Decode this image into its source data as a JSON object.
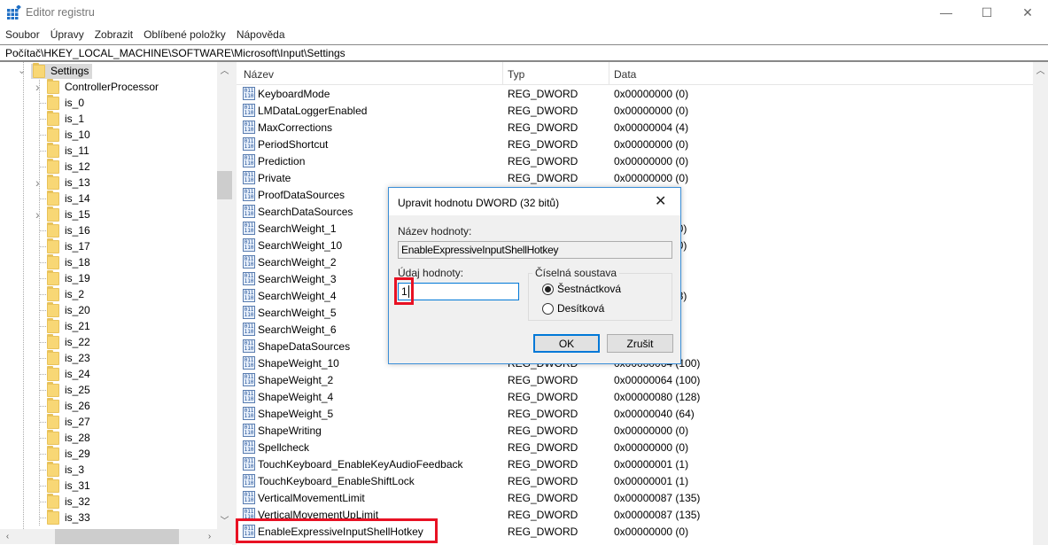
{
  "window": {
    "title": "Editor registru",
    "minimize": "—",
    "maximize": "☐",
    "close": "✕"
  },
  "menu": [
    "Soubor",
    "Úpravy",
    "Zobrazit",
    "Oblíbené položky",
    "Nápověda"
  ],
  "address": "Počítač\\HKEY_LOCAL_MACHINE\\SOFTWARE\\Microsoft\\Input\\Settings",
  "tree": {
    "selected": "Settings",
    "children": [
      {
        "label": "ControllerProcessor",
        "expandable": true
      },
      {
        "label": "is_0"
      },
      {
        "label": "is_1"
      },
      {
        "label": "is_10"
      },
      {
        "label": "is_11"
      },
      {
        "label": "is_12"
      },
      {
        "label": "is_13",
        "expandable": true
      },
      {
        "label": "is_14"
      },
      {
        "label": "is_15",
        "expandable": true
      },
      {
        "label": "is_16"
      },
      {
        "label": "is_17"
      },
      {
        "label": "is_18"
      },
      {
        "label": "is_19"
      },
      {
        "label": "is_2"
      },
      {
        "label": "is_20"
      },
      {
        "label": "is_21"
      },
      {
        "label": "is_22"
      },
      {
        "label": "is_23"
      },
      {
        "label": "is_24"
      },
      {
        "label": "is_25"
      },
      {
        "label": "is_26"
      },
      {
        "label": "is_27"
      },
      {
        "label": "is_28"
      },
      {
        "label": "is_29"
      },
      {
        "label": "is_3"
      },
      {
        "label": "is_31"
      },
      {
        "label": "is_32"
      },
      {
        "label": "is_33"
      }
    ]
  },
  "list": {
    "columns": [
      "Název",
      "Typ",
      "Data"
    ],
    "rows": [
      {
        "name": "KeyboardMode",
        "type": "REG_DWORD",
        "data": "0x00000000 (0)"
      },
      {
        "name": "LMDataLoggerEnabled",
        "type": "REG_DWORD",
        "data": "0x00000000 (0)"
      },
      {
        "name": "MaxCorrections",
        "type": "REG_DWORD",
        "data": "0x00000004 (4)"
      },
      {
        "name": "PeriodShortcut",
        "type": "REG_DWORD",
        "data": "0x00000000 (0)"
      },
      {
        "name": "Prediction",
        "type": "REG_DWORD",
        "data": "0x00000000 (0)"
      },
      {
        "name": "Private",
        "type": "REG_DWORD",
        "data": "0x00000000 (0)"
      },
      {
        "name": "ProofDataSources",
        "type": "",
        "data": ""
      },
      {
        "name": "SearchDataSources",
        "type": "",
        "data": ""
      },
      {
        "name": "SearchWeight_1",
        "type": "",
        "data": "00)"
      },
      {
        "name": "SearchWeight_10",
        "type": "",
        "data": "00)"
      },
      {
        "name": "SearchWeight_2",
        "type": "",
        "data": ""
      },
      {
        "name": "SearchWeight_3",
        "type": "",
        "data": ""
      },
      {
        "name": "SearchWeight_4",
        "type": "",
        "data": "28)"
      },
      {
        "name": "SearchWeight_5",
        "type": "",
        "data": "4)"
      },
      {
        "name": "SearchWeight_6",
        "type": "",
        "data": ""
      },
      {
        "name": "ShapeDataSources",
        "type": "",
        "data": "5)"
      },
      {
        "name": "ShapeWeight_10",
        "type": "REG_DWORD",
        "data": "0x00000064 (100)"
      },
      {
        "name": "ShapeWeight_2",
        "type": "REG_DWORD",
        "data": "0x00000064 (100)"
      },
      {
        "name": "ShapeWeight_4",
        "type": "REG_DWORD",
        "data": "0x00000080 (128)"
      },
      {
        "name": "ShapeWeight_5",
        "type": "REG_DWORD",
        "data": "0x00000040 (64)"
      },
      {
        "name": "ShapeWriting",
        "type": "REG_DWORD",
        "data": "0x00000000 (0)"
      },
      {
        "name": "Spellcheck",
        "type": "REG_DWORD",
        "data": "0x00000000 (0)"
      },
      {
        "name": "TouchKeyboard_EnableKeyAudioFeedback",
        "type": "REG_DWORD",
        "data": "0x00000001 (1)"
      },
      {
        "name": "TouchKeyboard_EnableShiftLock",
        "type": "REG_DWORD",
        "data": "0x00000001 (1)"
      },
      {
        "name": "VerticalMovementLimit",
        "type": "REG_DWORD",
        "data": "0x00000087 (135)"
      },
      {
        "name": "VerticalMovementUpLimit",
        "type": "REG_DWORD",
        "data": "0x00000087 (135)"
      },
      {
        "name": "EnableExpressiveInputShellHotkey",
        "type": "REG_DWORD",
        "data": "0x00000000 (0)",
        "highlighted": true
      }
    ]
  },
  "dialog": {
    "title": "Upravit hodnotu DWORD (32 bitů)",
    "name_label": "Název hodnoty:",
    "name_value": "EnableExpressiveInputShellHotkey",
    "value_label": "Údaj hodnoty:",
    "value": "1",
    "base_label": "Číselná soustava",
    "hex_label": "Šestnáctková",
    "dec_label": "Desítková",
    "selected_base": "hex",
    "ok": "OK",
    "cancel": "Zrušit"
  },
  "colors": {
    "highlight": "#e81123",
    "accent": "#0078d7"
  }
}
